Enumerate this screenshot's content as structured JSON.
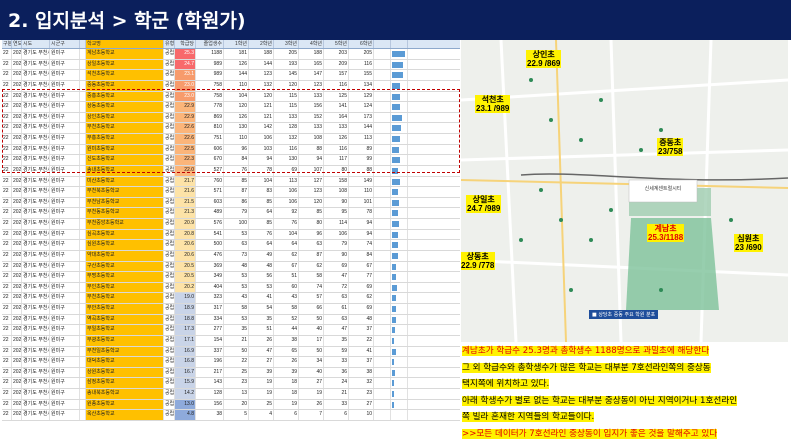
{
  "title": "2. 입지분석 > 학군 (학원가)",
  "sheet": {
    "headers": [
      "구분",
      "연도",
      "시도",
      "시군구",
      "",
      "학교명",
      "유형",
      "졸업생수",
      "1학년",
      "2학년",
      "3학년",
      "4학년",
      "5학년",
      "6학년",
      "학급당"
    ],
    "rows": [
      {
        "no": "22",
        "yr": "2021",
        "sido": "경기도 부천시",
        "gu": "원미구",
        "school": "계남초등학교",
        "type": "공립",
        "ratio": "25.3",
        "n": "1188",
        "g1": "181",
        "g2": "188",
        "g3": "205",
        "g4": "188",
        "g5": "203",
        "g6": "205",
        "bar": 0.9,
        "cls": "hot"
      },
      {
        "no": "22",
        "yr": "2021",
        "sido": "경기도 부천시",
        "gu": "원미구",
        "school": "상일초등학교",
        "type": "공립",
        "ratio": "24.7",
        "n": "989",
        "g1": "126",
        "g2": "144",
        "g3": "193",
        "g4": "165",
        "g5": "209",
        "g6": "116",
        "bar": 0.8,
        "cls": "hot"
      },
      {
        "no": "22",
        "yr": "2021",
        "sido": "경기도 부천시",
        "gu": "원미구",
        "school": "석천초등학교",
        "type": "공립",
        "ratio": "23.1",
        "n": "989",
        "g1": "144",
        "g2": "123",
        "g3": "145",
        "g4": "147",
        "g5": "157",
        "g6": "155",
        "bar": 0.8,
        "cls": "hot mid"
      },
      {
        "no": "22",
        "yr": "2021",
        "sido": "경기도 부천시",
        "gu": "원미구",
        "school": "중동초등학교",
        "type": "공립",
        "ratio": "23.0",
        "n": "758",
        "g1": "110",
        "g2": "132",
        "g3": "120",
        "g4": "123",
        "g5": "116",
        "g6": "134",
        "bar": 0.6,
        "cls": "hot mid"
      },
      {
        "no": "22",
        "yr": "2021",
        "sido": "경기도 부천시",
        "gu": "원미구",
        "school": "중흥초등학교",
        "type": "공립",
        "ratio": "23.0",
        "n": "758",
        "g1": "104",
        "g2": "120",
        "g3": "115",
        "g4": "133",
        "g5": "125",
        "g6": "129",
        "bar": 0.6,
        "cls": "hot mid"
      },
      {
        "no": "22",
        "yr": "2021",
        "sido": "경기도 부천시",
        "gu": "원미구",
        "school": "상동초등학교",
        "type": "공립",
        "ratio": "22.9",
        "n": "778",
        "g1": "120",
        "g2": "121",
        "g3": "115",
        "g4": "156",
        "g5": "141",
        "g6": "124",
        "bar": 0.6,
        "cls": "warm"
      },
      {
        "no": "22",
        "yr": "2021",
        "sido": "경기도 부천시",
        "gu": "원미구",
        "school": "상인초등학교",
        "type": "공립",
        "ratio": "22.9",
        "n": "869",
        "g1": "126",
        "g2": "121",
        "g3": "133",
        "g4": "152",
        "g5": "164",
        "g6": "173",
        "bar": 0.7,
        "cls": "warm"
      },
      {
        "no": "22",
        "yr": "2021",
        "sido": "경기도 부천시",
        "gu": "원미구",
        "school": "부천초등학교",
        "type": "공립",
        "ratio": "22.6",
        "n": "810",
        "g1": "130",
        "g2": "142",
        "g3": "128",
        "g4": "133",
        "g5": "133",
        "g6": "144",
        "bar": 0.65,
        "cls": "warm"
      },
      {
        "no": "22",
        "yr": "2021",
        "sido": "경기도 부천시",
        "gu": "원미구",
        "school": "부흥초등학교",
        "type": "공립",
        "ratio": "22.6",
        "n": "751",
        "g1": "110",
        "g2": "106",
        "g3": "132",
        "g4": "108",
        "g5": "126",
        "g6": "113",
        "bar": 0.6,
        "cls": "warm"
      },
      {
        "no": "22",
        "yr": "2021",
        "sido": "경기도 부천시",
        "gu": "원미구",
        "school": "원미초등학교",
        "type": "공립",
        "ratio": "22.5",
        "n": "606",
        "g1": "96",
        "g2": "103",
        "g3": "116",
        "g4": "88",
        "g5": "116",
        "g6": "89",
        "bar": 0.5,
        "cls": "warm"
      },
      {
        "no": "22",
        "yr": "2021",
        "sido": "경기도 부천시",
        "gu": "원미구",
        "school": "신도초등학교",
        "type": "공립",
        "ratio": "22.3",
        "n": "670",
        "g1": "84",
        "g2": "94",
        "g3": "130",
        "g4": "94",
        "g5": "117",
        "g6": "99",
        "bar": 0.55,
        "cls": "warm"
      },
      {
        "no": "22",
        "yr": "2021",
        "sido": "경기도 부천시",
        "gu": "원미구",
        "school": "송내초등학교",
        "type": "공립",
        "ratio": "22.0",
        "n": "527",
        "g1": "76",
        "g2": "78",
        "g3": "69",
        "g4": "107",
        "g5": "80",
        "g6": "88",
        "bar": 0.45,
        "cls": "warm"
      },
      {
        "no": "22",
        "yr": "2021",
        "sido": "경기도 부천시",
        "gu": "원미구",
        "school": "미산초등학교",
        "type": "공립",
        "ratio": "21.7",
        "n": "760",
        "g1": "85",
        "g2": "104",
        "g3": "113",
        "g4": "127",
        "g5": "158",
        "g6": "149",
        "bar": 0.6,
        "cls": "cool"
      },
      {
        "no": "22",
        "yr": "2021",
        "sido": "경기도 부천시",
        "gu": "원미구",
        "school": "부천북초등학교",
        "type": "공립",
        "ratio": "21.6",
        "n": "571",
        "g1": "87",
        "g2": "83",
        "g3": "106",
        "g4": "123",
        "g5": "108",
        "g6": "110",
        "bar": 0.45,
        "cls": "cool"
      },
      {
        "no": "22",
        "yr": "2021",
        "sido": "경기도 부천시",
        "gu": "원미구",
        "school": "부천남초등학교",
        "type": "공립",
        "ratio": "21.5",
        "n": "603",
        "g1": "86",
        "g2": "85",
        "g3": "106",
        "g4": "120",
        "g5": "90",
        "g6": "101",
        "bar": 0.5,
        "cls": "cool"
      },
      {
        "no": "22",
        "yr": "2021",
        "sido": "경기도 부천시",
        "gu": "원미구",
        "school": "부천동초등학교",
        "type": "공립",
        "ratio": "21.3",
        "n": "489",
        "g1": "79",
        "g2": "64",
        "g3": "92",
        "g4": "85",
        "g5": "95",
        "g6": "78",
        "bar": 0.4,
        "cls": "cool"
      },
      {
        "no": "22",
        "yr": "2021",
        "sido": "경기도 부천시",
        "gu": "원미구",
        "school": "부천중앙초등학교",
        "type": "공립",
        "ratio": "20.9",
        "n": "576",
        "g1": "100",
        "g2": "85",
        "g3": "76",
        "g4": "80",
        "g5": "114",
        "g6": "94",
        "bar": 0.47,
        "cls": "cool"
      },
      {
        "no": "22",
        "yr": "2021",
        "sido": "경기도 부천시",
        "gu": "원미구",
        "school": "심곡초등학교",
        "type": "공립",
        "ratio": "20.8",
        "n": "541",
        "g1": "53",
        "g2": "76",
        "g3": "104",
        "g4": "96",
        "g5": "106",
        "g6": "94",
        "bar": 0.45,
        "cls": "cool"
      },
      {
        "no": "22",
        "yr": "2021",
        "sido": "경기도 부천시",
        "gu": "원미구",
        "school": "심원초등학교",
        "type": "공립",
        "ratio": "20.6",
        "n": "500",
        "g1": "63",
        "g2": "64",
        "g3": "64",
        "g4": "63",
        "g5": "79",
        "g6": "74",
        "bar": 0.42,
        "cls": "cool"
      },
      {
        "no": "22",
        "yr": "2021",
        "sido": "경기도 부천시",
        "gu": "원미구",
        "school": "약대초등학교",
        "type": "공립",
        "ratio": "20.6",
        "n": "476",
        "g1": "73",
        "g2": "49",
        "g3": "62",
        "g4": "87",
        "g5": "90",
        "g6": "84",
        "bar": 0.4,
        "cls": "cool"
      },
      {
        "no": "22",
        "yr": "2021",
        "sido": "경기도 부천시",
        "gu": "원미구",
        "school": "구산초등학교",
        "type": "공립",
        "ratio": "20.5",
        "n": "369",
        "g1": "48",
        "g2": "48",
        "g3": "67",
        "g4": "62",
        "g5": "69",
        "g6": "67",
        "bar": 0.3,
        "cls": "cool"
      },
      {
        "no": "22",
        "yr": "2021",
        "sido": "경기도 부천시",
        "gu": "원미구",
        "school": "부명초등학교",
        "type": "공립",
        "ratio": "20.5",
        "n": "349",
        "g1": "53",
        "g2": "56",
        "g3": "51",
        "g4": "58",
        "g5": "47",
        "g6": "77",
        "bar": 0.3,
        "cls": "cool"
      },
      {
        "no": "22",
        "yr": "2021",
        "sido": "경기도 부천시",
        "gu": "원미구",
        "school": "부인초등학교",
        "type": "공립",
        "ratio": "20.2",
        "n": "404",
        "g1": "53",
        "g2": "53",
        "g3": "60",
        "g4": "74",
        "g5": "72",
        "g6": "69",
        "bar": 0.35,
        "cls": "cool"
      },
      {
        "no": "22",
        "yr": "2021",
        "sido": "경기도 부천시",
        "gu": "원미구",
        "school": "부천초등학교",
        "type": "공립",
        "ratio": "19.0",
        "n": "323",
        "g1": "43",
        "g2": "41",
        "g3": "43",
        "g4": "57",
        "g5": "63",
        "g6": "62",
        "bar": 0.28,
        "cls": "cold"
      },
      {
        "no": "22",
        "yr": "2021",
        "sido": "경기도 부천시",
        "gu": "원미구",
        "school": "부안초등학교",
        "type": "공립",
        "ratio": "18.9",
        "n": "317",
        "g1": "58",
        "g2": "54",
        "g3": "58",
        "g4": "66",
        "g5": "61",
        "g6": "69",
        "bar": 0.27,
        "cls": "cold"
      },
      {
        "no": "22",
        "yr": "2021",
        "sido": "경기도 부천시",
        "gu": "원미구",
        "school": "역곡초등학교",
        "type": "공립",
        "ratio": "18.8",
        "n": "334",
        "g1": "53",
        "g2": "35",
        "g3": "52",
        "g4": "50",
        "g5": "63",
        "g6": "48",
        "bar": 0.28,
        "cls": "cold"
      },
      {
        "no": "22",
        "yr": "2021",
        "sido": "경기도 부천시",
        "gu": "원미구",
        "school": "부일초등학교",
        "type": "공립",
        "ratio": "17.3",
        "n": "277",
        "g1": "35",
        "g2": "51",
        "g3": "44",
        "g4": "40",
        "g5": "47",
        "g6": "37",
        "bar": 0.24,
        "cls": "cold"
      },
      {
        "no": "22",
        "yr": "2021",
        "sido": "경기도 부천시",
        "gu": "원미구",
        "school": "부광초등학교",
        "type": "공립",
        "ratio": "17.1",
        "n": "154",
        "g1": "21",
        "g2": "26",
        "g3": "38",
        "g4": "17",
        "g5": "35",
        "g6": "22",
        "bar": 0.13,
        "cls": "cold"
      },
      {
        "no": "22",
        "yr": "2021",
        "sido": "경기도 부천시",
        "gu": "원미구",
        "school": "부천일초등학교",
        "type": "공립",
        "ratio": "16.9",
        "n": "337",
        "g1": "50",
        "g2": "47",
        "g3": "65",
        "g4": "50",
        "g5": "59",
        "g6": "41",
        "bar": 0.28,
        "cls": "cold"
      },
      {
        "no": "22",
        "yr": "2021",
        "sido": "경기도 부천시",
        "gu": "원미구",
        "school": "대덕초등학교",
        "type": "공립",
        "ratio": "16.8",
        "n": "196",
        "g1": "22",
        "g2": "27",
        "g3": "26",
        "g4": "34",
        "g5": "33",
        "g6": "37",
        "bar": 0.17,
        "cls": "cold"
      },
      {
        "no": "22",
        "yr": "2021",
        "sido": "경기도 부천시",
        "gu": "원미구",
        "school": "상원초등학교",
        "type": "공립",
        "ratio": "16.7",
        "n": "217",
        "g1": "25",
        "g2": "39",
        "g3": "39",
        "g4": "40",
        "g5": "36",
        "g6": "38",
        "bar": 0.18,
        "cls": "cold"
      },
      {
        "no": "22",
        "yr": "2021",
        "sido": "경기도 부천시",
        "gu": "원미구",
        "school": "삼정초등학교",
        "type": "공립",
        "ratio": "15.9",
        "n": "143",
        "g1": "23",
        "g2": "19",
        "g3": "18",
        "g4": "27",
        "g5": "24",
        "g6": "32",
        "bar": 0.12,
        "cls": "cold"
      },
      {
        "no": "22",
        "yr": "2021",
        "sido": "경기도 부천시",
        "gu": "원미구",
        "school": "송내북초등학교",
        "type": "공립",
        "ratio": "14.2",
        "n": "128",
        "g1": "13",
        "g2": "19",
        "g3": "18",
        "g4": "19",
        "g5": "21",
        "g6": "23",
        "bar": 0.11,
        "cls": "cold"
      },
      {
        "no": "22",
        "yr": "2021",
        "sido": "경기도 부천시",
        "gu": "원미구",
        "school": "원종초등학교",
        "type": "공립",
        "ratio": "13.0",
        "n": "156",
        "g1": "20",
        "g2": "25",
        "g3": "19",
        "g4": "26",
        "g5": "33",
        "g6": "27",
        "bar": 0.13,
        "cls": "blue"
      },
      {
        "no": "22",
        "yr": "2021",
        "sido": "경기도 부천시",
        "gu": "원미구",
        "school": "옥산초등학교",
        "type": "공립",
        "ratio": "4.8",
        "n": "38",
        "g1": "5",
        "g2": "4",
        "g3": "6",
        "g4": "7",
        "g5": "6",
        "g6": "10",
        "bar": 0.03,
        "cls": "blue"
      }
    ]
  },
  "map": {
    "labels": [
      {
        "name": "상인초",
        "value": "22.9 /869",
        "highlight": false
      },
      {
        "name": "석천초",
        "value": "23.1 /989",
        "highlight": false
      },
      {
        "name": "중동초",
        "value": "23/758",
        "highlight": false
      },
      {
        "name": "상일초",
        "value": "24.7 /989",
        "highlight": false
      },
      {
        "name": "계남초",
        "value": "25.3/1188",
        "highlight": true
      },
      {
        "name": "심원초",
        "value": "23 /690",
        "highlight": false
      },
      {
        "name": "상동초",
        "value": "22.9 /778",
        "highlight": false
      }
    ],
    "legend_text": "신세계센트럴시티",
    "bottom_tag": "■ 상당초 중동 주요 학원 분포"
  },
  "notes": [
    {
      "text": "계남초가 학급수 25.3명과 총학생수 1188명으로 과밀초에 해당한다",
      "red": true
    },
    {
      "text": "그 외 학급수와 총학생수가 많은 학교는 대부분 7호선라인쪽의 중상동",
      "red": false
    },
    {
      "text": "택지쪽에 위치하고 있다.",
      "red": false
    },
    {
      "text": "아래 학생수가 별로 없는 학교는 대부분 중상동이 아닌 지역이거나 1호선라인",
      "red": false
    },
    {
      "text": "쪽 빌라 혼재한 지역들의 학교들이다.",
      "red": false
    },
    {
      "text": ">>모든 데이터가 7호선라인 중상동이 입지가 좋은 것을 말해주고 있다",
      "red": true
    }
  ]
}
